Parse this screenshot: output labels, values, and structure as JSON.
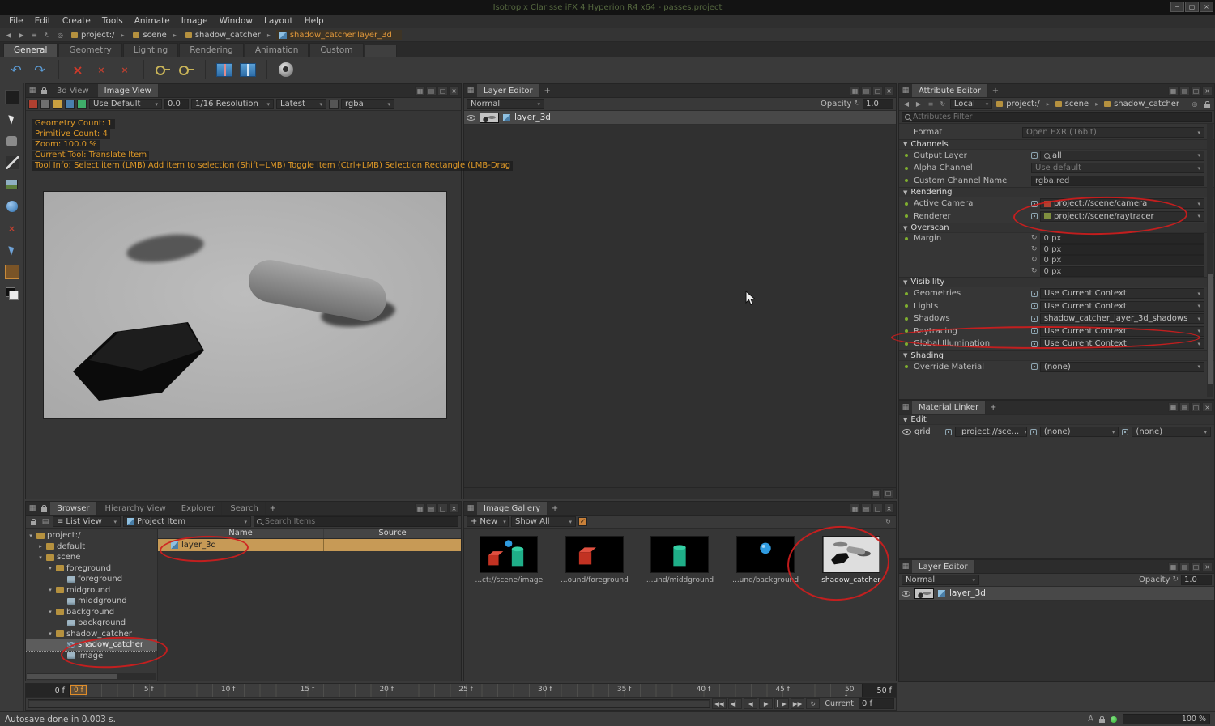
{
  "icons": {
    "window_min": "─",
    "window_max": "▢",
    "window_close": "×",
    "panel_float": "▦",
    "panel_split": "▤",
    "panel_frame": "□",
    "panel_close": "×",
    "undo": "↶",
    "redo": "↷",
    "delete": "×",
    "small_delete": "×",
    "back": "◀",
    "forward": "▶",
    "menu": "≡",
    "refresh": "↻",
    "history": "◎",
    "bookmark": "◎",
    "plus": "+",
    "check": "✓",
    "list": "≡",
    "rew": "◀◀",
    "prev_key": "◀▏",
    "prev": "◀",
    "play": "▶",
    "next_key": "▏▶",
    "ffwd": "▶▶",
    "loop": "↻"
  },
  "colors": {
    "annotation_red": "#cf1d1d",
    "selection_tan": "#c79a56",
    "accent_orange": "#e0973a"
  },
  "window": {
    "title": "Isotropix Clarisse iFX 4 Hyperion R4 x64 - passes.project"
  },
  "menu": {
    "items": [
      "File",
      "Edit",
      "Create",
      "Tools",
      "Animate",
      "Image",
      "Window",
      "Layout",
      "Help"
    ]
  },
  "pathbar": {
    "segments": [
      "project:/",
      "scene",
      "shadow_catcher"
    ],
    "current": "shadow_catcher.layer_3d"
  },
  "shelf": {
    "tabs": [
      "General",
      "Geometry",
      "Lighting",
      "Rendering",
      "Animation",
      "Custom"
    ]
  },
  "image_view": {
    "tabs": {
      "view3d": "3d View",
      "image": "Image View"
    },
    "toolbar": {
      "display": "Use Default",
      "exposure": "0.0",
      "resolution": "1/16 Resolution",
      "history": "Latest",
      "channel": "rgba"
    },
    "info": {
      "geometry_count": "Geometry Count: 1",
      "primitive_count": "Primitive Count: 4",
      "zoom": "Zoom: 100.0 %",
      "current_tool": "Current Tool: Translate Item",
      "tool_info": "Tool Info: Select item (LMB)  Add item to selection (Shift+LMB)  Toggle item (Ctrl+LMB)  Selection Rectangle (LMB-Drag"
    }
  },
  "layer_editor": {
    "title": "Layer Editor",
    "blend_mode": "Normal",
    "opacity_label": "Opacity",
    "opacity_value": "1.0",
    "layer_name": "layer_3d"
  },
  "attribute_editor": {
    "title": "Attribute Editor",
    "scope": "Local",
    "path": [
      "project:/",
      "scene",
      "shadow_catcher"
    ],
    "filter_placeholder": "Attributes Filter",
    "sections": {
      "channels": "Channels",
      "rendering": "Rendering",
      "overscan": "Overscan",
      "visibility": "Visibility",
      "shading": "Shading"
    },
    "rows": {
      "format": {
        "label": "Format",
        "value": "Open EXR (16bit)"
      },
      "output_layer": {
        "label": "Output Layer",
        "value": "all"
      },
      "alpha_channel": {
        "label": "Alpha Channel",
        "value": "Use default"
      },
      "custom_channel_name": {
        "label": "Custom Channel Name",
        "value": "rgba.red"
      },
      "active_camera": {
        "label": "Active Camera",
        "value": "project://scene/camera"
      },
      "renderer": {
        "label": "Renderer",
        "value": "project://scene/raytracer"
      },
      "margin": {
        "label": "Margin",
        "values": [
          "0 px",
          "0 px",
          "0 px",
          "0 px"
        ]
      },
      "geometries": {
        "label": "Geometries",
        "value": "Use Current Context"
      },
      "lights": {
        "label": "Lights",
        "value": "Use Current Context"
      },
      "shadows": {
        "label": "Shadows",
        "value": "shadow_catcher_layer_3d_shadows"
      },
      "raytracing": {
        "label": "Raytracing",
        "value": "Use Current Context"
      },
      "global_illumination": {
        "label": "Global Illumination",
        "value": "Use Current Context"
      },
      "override_material": {
        "label": "Override Material",
        "value": "(none)"
      }
    }
  },
  "material_linker": {
    "title": "Material Linker",
    "edit_label": "Edit",
    "row": {
      "name": "grid",
      "target": "project://sce...",
      "material": "(none)",
      "clip_map": "(none)"
    }
  },
  "browser": {
    "tabs": [
      "Browser",
      "Hierarchy View",
      "Explorer",
      "Search"
    ],
    "toolbar": {
      "view_mode": "List View",
      "filter": "Project Item",
      "search_placeholder": "Search Items"
    },
    "columns": {
      "name": "Name",
      "source": "Source"
    },
    "row": {
      "name": "layer_3d",
      "source": ""
    },
    "tree": {
      "items": [
        {
          "label": "project:/"
        },
        {
          "label": "default"
        },
        {
          "label": "scene"
        },
        {
          "label": "foreground"
        },
        {
          "label": "foreground"
        },
        {
          "label": "midground"
        },
        {
          "label": "middground"
        },
        {
          "label": "background"
        },
        {
          "label": "background"
        },
        {
          "label": "shadow_catcher"
        },
        {
          "label": "shadow_catcher"
        },
        {
          "label": "image"
        }
      ]
    }
  },
  "gallery": {
    "title": "Image Gallery",
    "new_label": "New",
    "filter": "Show All",
    "items": [
      {
        "caption": "...ct://scene/image"
      },
      {
        "caption": "...ound/foreground"
      },
      {
        "caption": "...und/middground"
      },
      {
        "caption": "...und/background"
      },
      {
        "caption": "shadow_catcher"
      }
    ]
  },
  "timeline": {
    "range_start": "0 f",
    "range_end": "50 f",
    "marker": "0 f",
    "ticks": [
      "5 f",
      "10 f",
      "15 f",
      "20 f",
      "25 f",
      "30 f",
      "35 f",
      "40 f",
      "45 f",
      "50 f"
    ],
    "current_label": "Current",
    "current_value": "0 f"
  },
  "statusbar": {
    "message": "Autosave done in 0.003 s.",
    "autosave_indicator": "A",
    "progress": "100 %"
  }
}
